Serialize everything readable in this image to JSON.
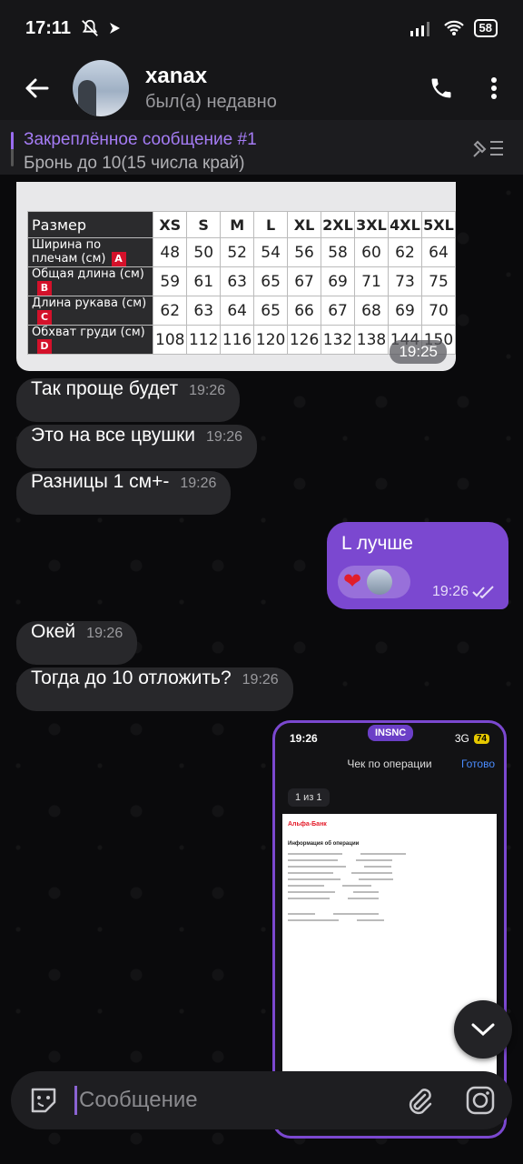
{
  "status_bar": {
    "time": "17:11",
    "battery": "58"
  },
  "header": {
    "name": "xanax",
    "status": "был(а) недавно"
  },
  "pinned": {
    "title": "Закреплённое сообщение #1",
    "text": "Бронь до 10(15 числа край)"
  },
  "size_chart": {
    "header_label": "Размер",
    "sizes": [
      "XS",
      "S",
      "M",
      "L",
      "XL",
      "2XL",
      "3XL",
      "4XL",
      "5XL"
    ],
    "rows": [
      {
        "label": "Ширина по плечам (см)",
        "letter": "A",
        "values": [
          "48",
          "50",
          "52",
          "54",
          "56",
          "58",
          "60",
          "62",
          "64"
        ]
      },
      {
        "label": "Общая длина (см)",
        "letter": "B",
        "values": [
          "59",
          "61",
          "63",
          "65",
          "67",
          "69",
          "71",
          "73",
          "75"
        ]
      },
      {
        "label": "Длина рукава (см)",
        "letter": "C",
        "values": [
          "62",
          "63",
          "64",
          "65",
          "66",
          "67",
          "68",
          "69",
          "70"
        ]
      },
      {
        "label": "Обхват груди (см)",
        "letter": "D",
        "values": [
          "108",
          "112",
          "116",
          "120",
          "126",
          "132",
          "138",
          "144",
          "150"
        ]
      }
    ],
    "time": "19:25"
  },
  "messages": [
    {
      "text": "Так проще будет",
      "time": "19:26"
    },
    {
      "text": "Это на все цвушки",
      "time": "19:26"
    },
    {
      "text": "Разницы 1 см+-",
      "time": "19:26"
    },
    {
      "text": "Окей",
      "time": "19:26"
    },
    {
      "text": "Тогда до 10 отложить?",
      "time": "19:26"
    }
  ],
  "outgoing": {
    "text": "L лучше",
    "time": "19:26",
    "reaction": "❤"
  },
  "screenshot": {
    "time": "19:26",
    "pill": "INSNC",
    "network": "3G",
    "battery": "74",
    "title": "Чек по операции",
    "done": "Готово",
    "page": "1 из 1",
    "bank": "Альфа-Банк",
    "receipt_title": "Информация об операции"
  },
  "composer": {
    "placeholder": "Сообщение"
  }
}
